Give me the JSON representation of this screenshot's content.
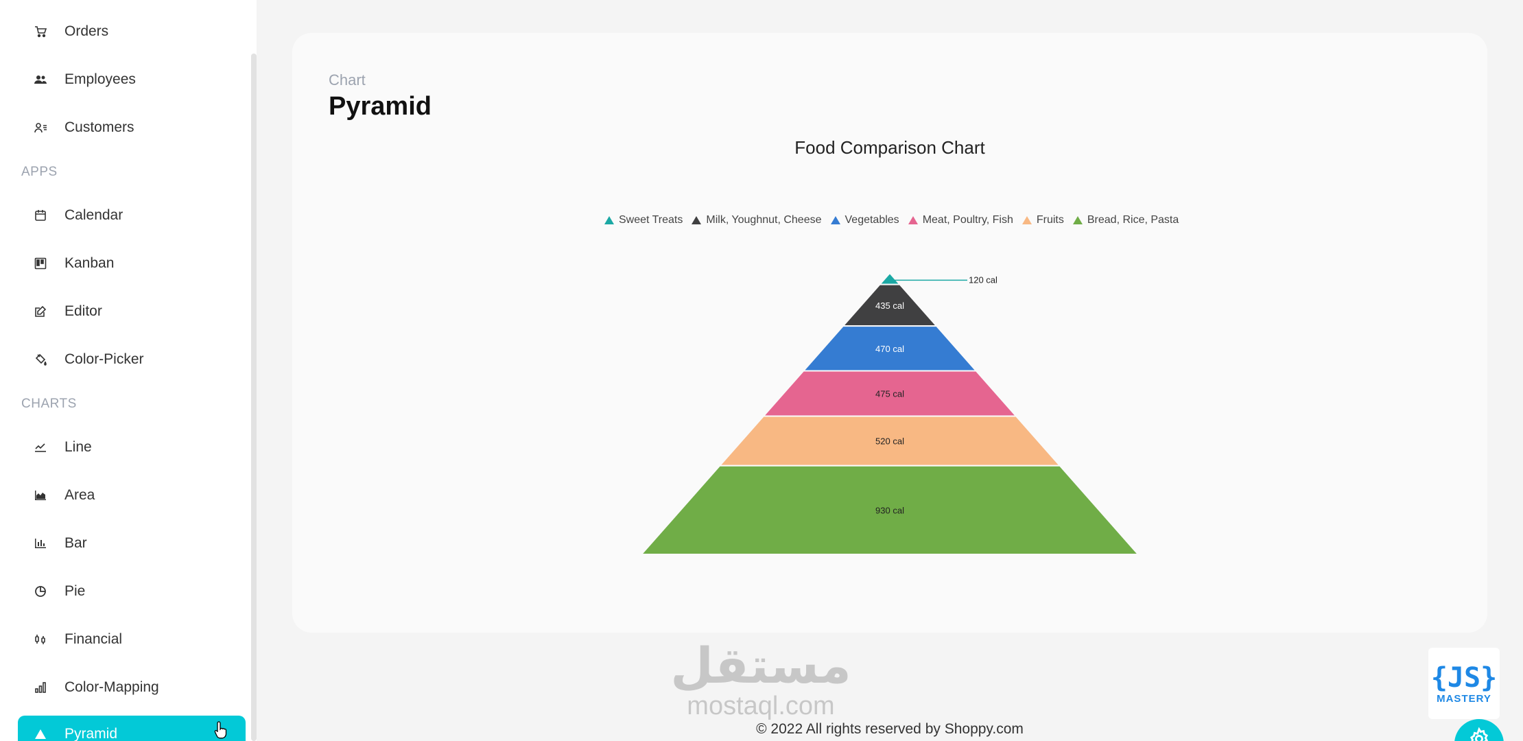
{
  "sidebar": {
    "items_top": [
      {
        "label": "Orders",
        "icon": "cart-icon"
      },
      {
        "label": "Employees",
        "icon": "employees-icon"
      },
      {
        "label": "Customers",
        "icon": "customers-icon"
      }
    ],
    "sections": [
      {
        "title": "APPS",
        "items": [
          {
            "label": "Calendar",
            "icon": "calendar-icon"
          },
          {
            "label": "Kanban",
            "icon": "kanban-icon"
          },
          {
            "label": "Editor",
            "icon": "edit-icon"
          },
          {
            "label": "Color-Picker",
            "icon": "paint-bucket-icon"
          }
        ]
      },
      {
        "title": "CHARTS",
        "items": [
          {
            "label": "Line",
            "icon": "line-chart-icon"
          },
          {
            "label": "Area",
            "icon": "area-chart-icon"
          },
          {
            "label": "Bar",
            "icon": "bar-chart-icon"
          },
          {
            "label": "Pie",
            "icon": "pie-chart-icon"
          },
          {
            "label": "Financial",
            "icon": "stock-icon"
          },
          {
            "label": "Color-Mapping",
            "icon": "color-mapping-icon"
          },
          {
            "label": "Pyramid",
            "icon": "pyramid-icon",
            "active": true
          }
        ]
      }
    ]
  },
  "header": {
    "category": "Chart",
    "title": "Pyramid"
  },
  "chart_data": {
    "type": "pyramid",
    "title": "Food Comparison Chart",
    "legend_position": "top",
    "unit": "cal",
    "series": [
      {
        "name": "Sweet Treats",
        "value": 120,
        "label": "120 cal",
        "color": "#1ba8a4"
      },
      {
        "name": "Milk, Youghnut, Cheese",
        "value": 435,
        "label": "435 cal",
        "color": "#404041"
      },
      {
        "name": "Vegetables",
        "value": 470,
        "label": "470 cal",
        "color": "#357cd2"
      },
      {
        "name": "Meat, Poultry, Fish",
        "value": 475,
        "label": "475 cal",
        "color": "#e56590"
      },
      {
        "name": "Fruits",
        "value": 520,
        "label": "520 cal",
        "color": "#f8b883"
      },
      {
        "name": "Bread, Rice, Pasta",
        "value": 930,
        "label": "930 cal",
        "color": "#70ad47"
      }
    ]
  },
  "footer": {
    "text": "© 2022 All rights reserved by Shoppy.com"
  },
  "watermark": {
    "arabic": "مستقل",
    "latin": "mostaql.com"
  },
  "brand_logo": {
    "js": "{JS}",
    "mastery": "MASTERY"
  },
  "colors": {
    "accent": "#03c9d7"
  }
}
